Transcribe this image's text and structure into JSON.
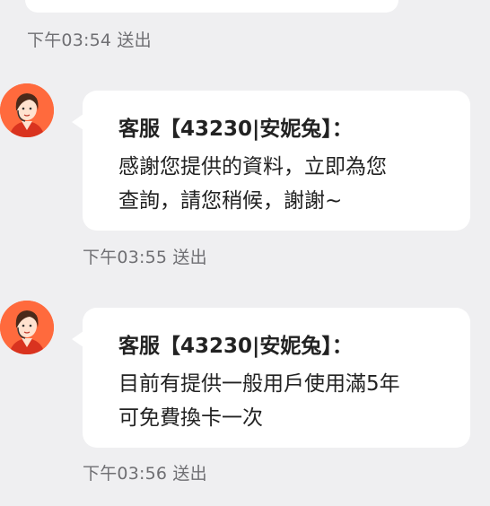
{
  "messages": [
    {
      "type": "sent",
      "timestamp": "下午03:54 送出"
    },
    {
      "type": "received",
      "sender": "客服【43230|安妮兔】：",
      "lines": [
        "感謝您提供的資料，立即為您",
        "查詢，請您稍候，謝謝~"
      ],
      "timestamp": "下午03:55 送出"
    },
    {
      "type": "received",
      "sender": "客服【43230|安妮兔】：",
      "lines": [
        "目前有提供一般用戶使用滿5年",
        "可免費換卡一次"
      ],
      "timestamp": "下午03:56 送出"
    }
  ],
  "colors": {
    "background": "#efeff1",
    "bubble": "#ffffff",
    "avatar_bg": "#ff6a3d",
    "text": "#222222",
    "timestamp": "#6f6f73"
  },
  "icons": {
    "agent_avatar": "customer-service-agent-avatar"
  }
}
